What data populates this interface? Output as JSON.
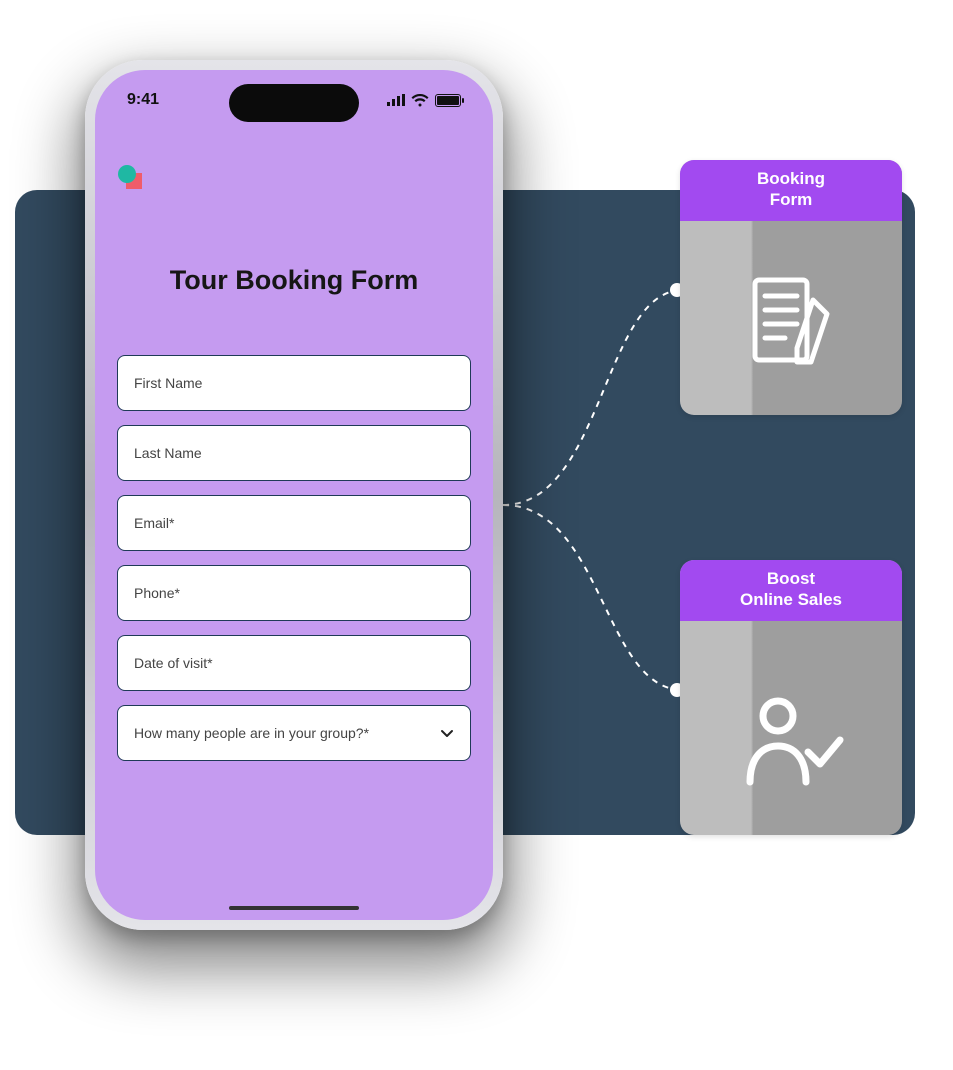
{
  "status": {
    "time": "9:41"
  },
  "form": {
    "title": "Tour Booking Form",
    "fields": {
      "firstName": "First Name",
      "lastName": "Last Name",
      "email": "Email*",
      "phone": "Phone*",
      "dateOfVisit": "Date of visit*",
      "groupSize": "How many people are in your group?*"
    }
  },
  "cards": {
    "bookingForm": {
      "line1": "Booking",
      "line2": "Form"
    },
    "boostSales": {
      "line1": "Boost",
      "line2": "Online Sales"
    }
  }
}
